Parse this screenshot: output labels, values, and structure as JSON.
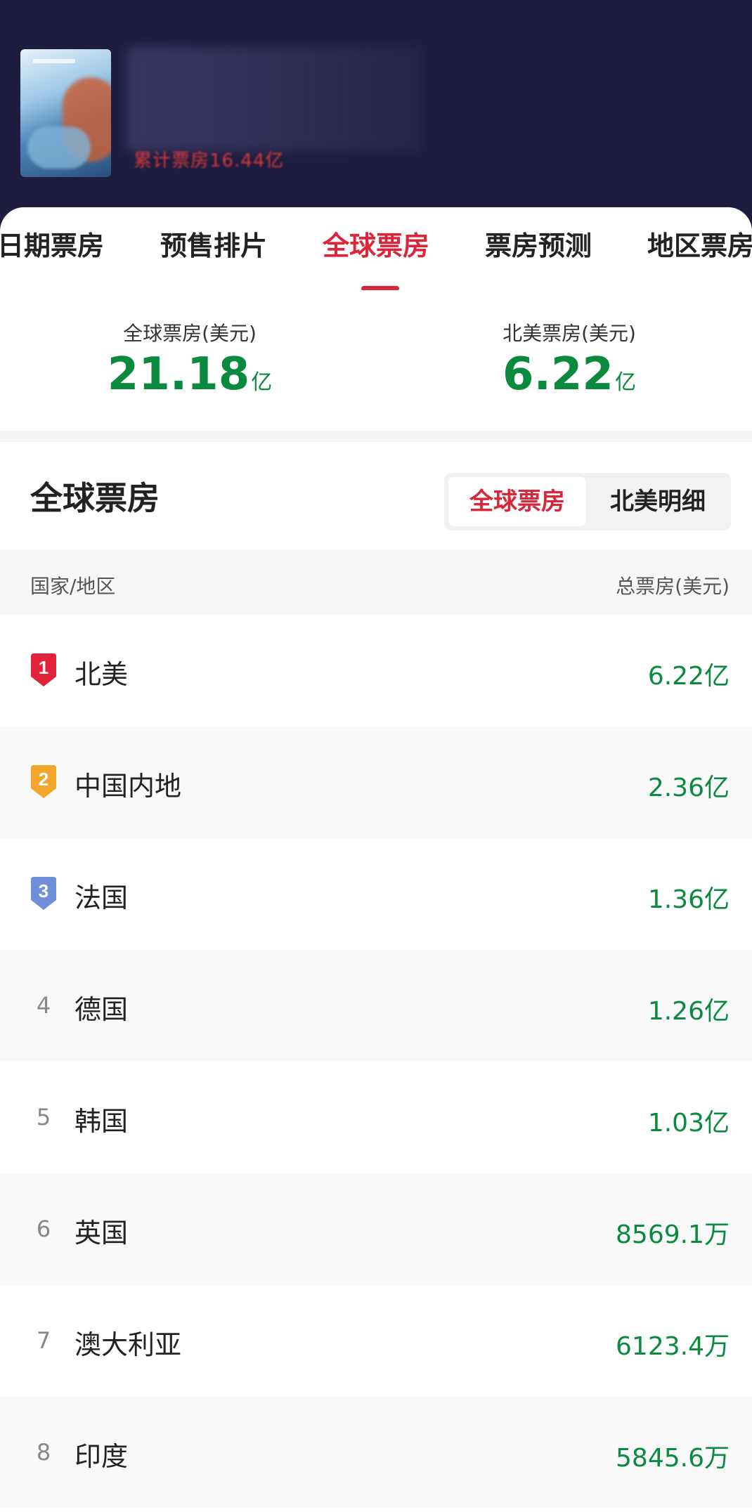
{
  "header": {
    "cumulative_text": "累计票房16.44亿"
  },
  "tabs": [
    {
      "label": "日期票房",
      "active": false
    },
    {
      "label": "预售排片",
      "active": false
    },
    {
      "label": "全球票房",
      "active": true
    },
    {
      "label": "票房预测",
      "active": false
    },
    {
      "label": "地区票房",
      "active": false
    }
  ],
  "summary": {
    "global": {
      "label": "全球票房(美元)",
      "value": "21.18",
      "unit": "亿"
    },
    "north_america": {
      "label": "北美票房(美元)",
      "value": "6.22",
      "unit": "亿"
    }
  },
  "section": {
    "title": "全球票房",
    "toggle": {
      "active": "全球票房",
      "inactive": "北美明细"
    }
  },
  "table": {
    "col_left": "国家/地区",
    "col_right": "总票房(美元)",
    "rows": [
      {
        "rank": "1",
        "country": "北美",
        "value": "6.22亿"
      },
      {
        "rank": "2",
        "country": "中国内地",
        "value": "2.36亿"
      },
      {
        "rank": "3",
        "country": "法国",
        "value": "1.36亿"
      },
      {
        "rank": "4",
        "country": "德国",
        "value": "1.26亿"
      },
      {
        "rank": "5",
        "country": "韩国",
        "value": "1.03亿"
      },
      {
        "rank": "6",
        "country": "英国",
        "value": "8569.1万"
      },
      {
        "rank": "7",
        "country": "澳大利亚",
        "value": "6123.4万"
      },
      {
        "rank": "8",
        "country": "印度",
        "value": "5845.6万"
      }
    ]
  },
  "colors": {
    "accent": "#d8263b",
    "value_green": "#0a8a3e",
    "header_bg": "#1e1c3f",
    "rank1": "#e0233a",
    "rank2": "#f4a52b",
    "rank3": "#6f8fd8"
  }
}
